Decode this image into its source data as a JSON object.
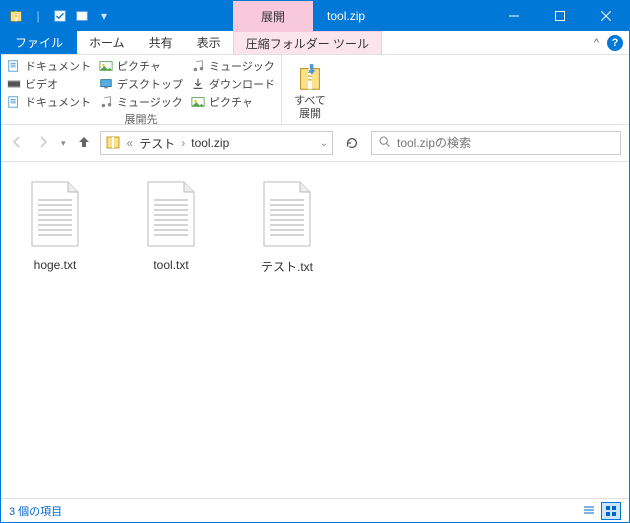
{
  "titlebar": {
    "context_tab": "展開",
    "title": "tool.zip"
  },
  "tabs": {
    "file": "ファイル",
    "home": "ホーム",
    "share": "共有",
    "view": "表示",
    "compressed": "圧縮フォルダー ツール"
  },
  "ribbon": {
    "dest": {
      "items": [
        [
          "ドキュメント",
          "ピクチャ",
          "ミュージック"
        ],
        [
          "ビデオ",
          "デスクトップ",
          "ダウンロード"
        ],
        [
          "ドキュメント",
          "ミュージック",
          "ピクチャ"
        ]
      ],
      "label": "展開先"
    },
    "extract_all": {
      "line1": "すべて",
      "line2": "展開"
    }
  },
  "breadcrumb": {
    "root": "テスト",
    "current": "tool.zip"
  },
  "search": {
    "placeholder": "tool.zipの検索"
  },
  "files": [
    {
      "name": "hoge.txt"
    },
    {
      "name": "tool.txt"
    },
    {
      "name": "テスト.txt"
    }
  ],
  "status": {
    "count_text": "3 個の項目"
  }
}
